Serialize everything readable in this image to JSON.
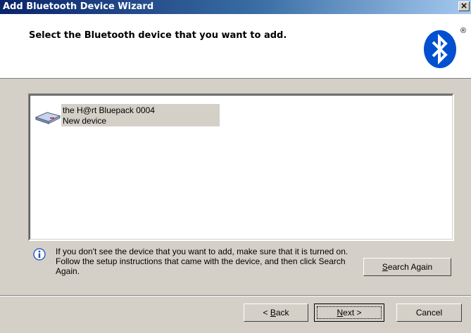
{
  "window": {
    "title": "Add Bluetooth Device Wizard",
    "close_label": "×"
  },
  "header": {
    "title": "Select the Bluetooth device that you want to add.",
    "logo_icon": "bluetooth-logo-icon",
    "registered_mark": "®",
    "brand_color": "#0050d0"
  },
  "devices": [
    {
      "name": "the H@rt Bluepack 0004",
      "status": "New device",
      "icon": "bluetooth-device-icon",
      "selected": true
    }
  ],
  "info": {
    "icon": "info-icon",
    "text": "If you don't see the device that you want to add, make sure that it is turned on. Follow the setup instructions that came with the device, and then click Search Again."
  },
  "buttons": {
    "search_again": {
      "pre": "",
      "accel": "S",
      "post": "earch Again"
    },
    "back": {
      "pre": "< ",
      "accel": "B",
      "post": "ack"
    },
    "next": {
      "pre": "",
      "accel": "N",
      "post": "ext >"
    },
    "cancel": "Cancel"
  }
}
